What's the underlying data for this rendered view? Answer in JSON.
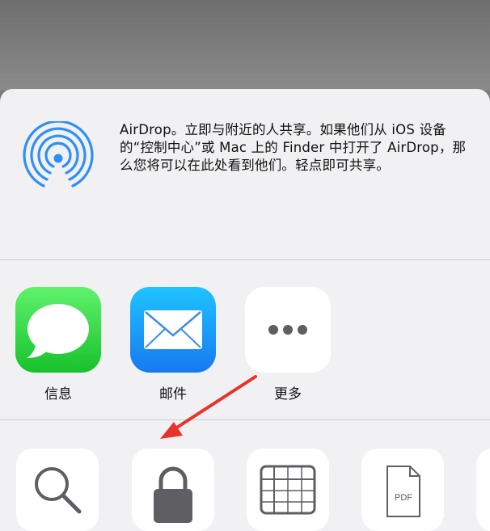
{
  "airdrop": {
    "description": "AirDrop。立即与附近的人共享。如果他们从 iOS 设备的“控制中心”或 Mac 上的 Finder 中打开了 AirDrop，那么您将可以在此处看到他们。轻点即可共享。",
    "icon": "airdrop-icon",
    "accent_color": "#2f8ff3"
  },
  "apps": [
    {
      "label": "信息",
      "icon": "messages-icon"
    },
    {
      "label": "邮件",
      "icon": "mail-icon"
    },
    {
      "label": "更多",
      "icon": "more-icon"
    }
  ],
  "actions": [
    {
      "icon": "search-icon"
    },
    {
      "icon": "lock-icon"
    },
    {
      "icon": "table-icon"
    },
    {
      "icon": "pdf-document-icon",
      "label": "PDF"
    }
  ],
  "annotation": {
    "arrow_color": "#e8332a"
  }
}
